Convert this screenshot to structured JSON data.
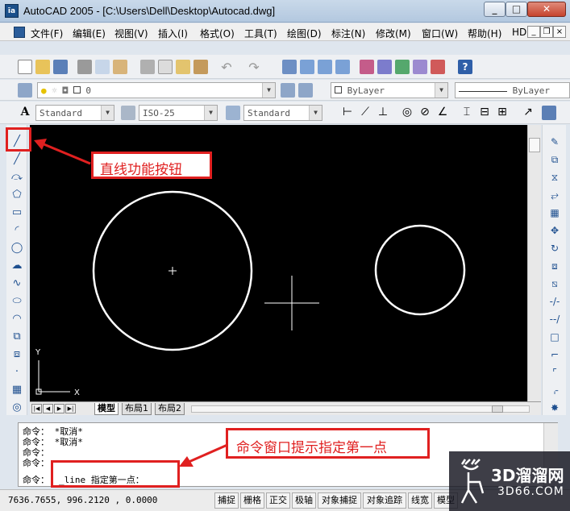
{
  "window": {
    "title": "AutoCAD 2005 - [C:\\Users\\Dell\\Desktop\\Autocad.dwg]",
    "app_icon_text": "ĩa"
  },
  "menu": [
    "文件(F)",
    "编辑(E)",
    "视图(V)",
    "插入(I)",
    "格式(O)",
    "工具(T)",
    "绘图(D)",
    "标注(N)",
    "修改(M)",
    "窗口(W)",
    "帮助(H)",
    "HDSHM"
  ],
  "layers": {
    "current": "0",
    "color": "ByLayer",
    "linetype": "ByLayer"
  },
  "styles": {
    "text_style": "Standard",
    "dim_style": "ISO-25",
    "table_style": "Standard"
  },
  "ucs": {
    "y_label": "Y",
    "x_label": "X"
  },
  "tabs": [
    "模型",
    "布局1",
    "布局2"
  ],
  "command_history": [
    "命令： *取消*",
    "命令： *取消*",
    "命令：",
    "命令："
  ],
  "command_prompt": {
    "label": "命令：",
    "input": "_line 指定第一点："
  },
  "status": {
    "coords": "7636.7655, 996.2120 , 0.0000",
    "toggles": [
      "捕捉",
      "栅格",
      "正交",
      "极轴",
      "对象捕捉",
      "对象追踪",
      "线宽",
      "模型"
    ]
  },
  "annotations": {
    "line_button": "直线功能按钮",
    "command_hint": "命令窗口提示指定第一点"
  },
  "watermark": {
    "brand": "3D溜溜网",
    "url": "3D66.COM"
  },
  "icons": [
    "line-icon",
    "polyline-icon",
    "circle-icon",
    "arc-icon",
    "rectangle-icon",
    "polygon-icon",
    "move-icon",
    "rotate-icon",
    "scale-icon",
    "mirror-icon",
    "copy-icon",
    "erase-icon"
  ],
  "colors": {
    "canvas": "#000000",
    "annotation": "#e02020",
    "toolbar": "#eef0f3"
  }
}
